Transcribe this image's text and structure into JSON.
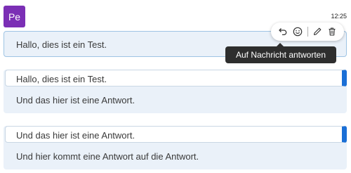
{
  "sender": {
    "initials": "Pe",
    "avatar_color": "#7b2fb5"
  },
  "timestamp": "12:25",
  "messages": [
    {
      "text": "Hallo, dies ist ein Test."
    },
    {
      "quote": "Hallo, dies ist ein Test.",
      "text": "Und das hier ist eine Antwort."
    },
    {
      "quote": "Und das hier ist eine Antwort.",
      "text": "Und hier kommt eine Antwort auf die Antwort."
    }
  ],
  "actions": {
    "tooltip": "Auf Nachricht antworten",
    "icons": [
      "reply-icon",
      "emoji-icon",
      "edit-icon",
      "trash-icon"
    ]
  },
  "colors": {
    "message_bg": "#eaf1f9",
    "quote_accent": "#1a6fd6",
    "tooltip_bg": "#2e2e2e"
  }
}
